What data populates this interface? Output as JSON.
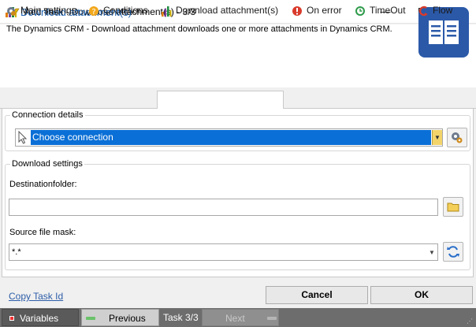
{
  "window": {
    "title": "Add Task - Download attachment(s) - 3/3",
    "minimize_glyph": "—",
    "close_glyph": "✕"
  },
  "header": {
    "title": "Download attachment(s)",
    "description": "The Dynamics CRM - Download attachment downloads one or more attachments in Dynamics CRM.",
    "icon": "book-icon"
  },
  "tabs": [
    {
      "label": "Main settings",
      "icon": "gear-icon"
    },
    {
      "label": "Conditions",
      "icon": "conditions-icon"
    },
    {
      "label": "Download attachment(s)",
      "icon": "dynamics-icon",
      "active": true
    },
    {
      "label": "On error",
      "icon": "error-icon"
    },
    {
      "label": "TimeOut",
      "icon": "timeout-icon"
    },
    {
      "label": "Flow",
      "icon": "flow-icon"
    }
  ],
  "connection": {
    "group_label": "Connection details",
    "selected": "Choose connection"
  },
  "download": {
    "group_label": "Download settings",
    "dest_label": "Destinationfolder:",
    "dest_value": "",
    "mask_label": "Source file mask:",
    "mask_value": "*.*"
  },
  "footer": {
    "copy_link": "Copy Task Id",
    "cancel": "Cancel",
    "ok": "OK"
  },
  "statusbar": {
    "variables": "Variables",
    "previous": "Previous",
    "task_counter": "Task 3/3",
    "next": "Next"
  },
  "colors": {
    "accent": "#0a6fd6",
    "header_title": "#1f62b0",
    "book_tile": "#2b59a8",
    "statusbar": "#6d6d6d"
  }
}
